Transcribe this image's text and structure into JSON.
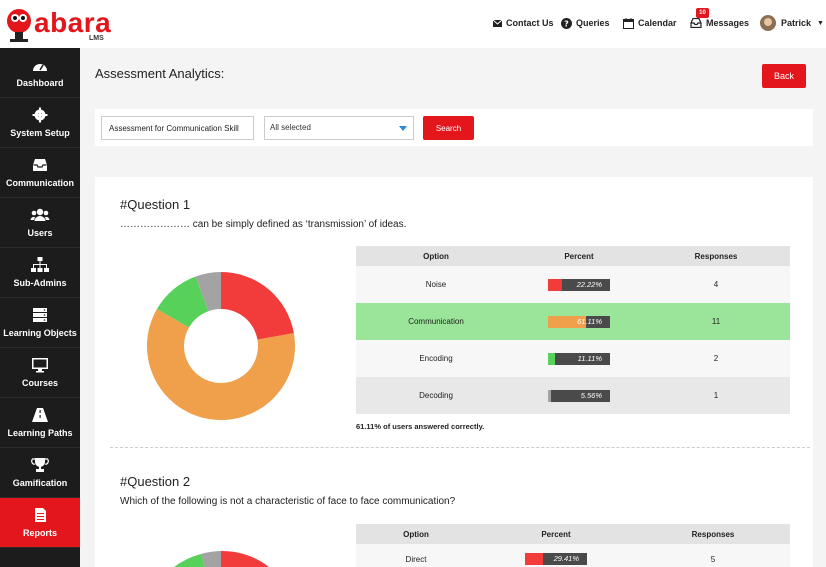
{
  "brand": {
    "name": "abara",
    "sub": "LMS",
    "accent": "#e3161c"
  },
  "topnav": {
    "contact": "Contact Us",
    "queries": "Queries",
    "calendar": "Calendar",
    "messages": "Messages",
    "messages_badge": "10",
    "user": "Patrick"
  },
  "sidebar": {
    "items": [
      {
        "label": "Dashboard",
        "icon": "dashboard-icon"
      },
      {
        "label": "System Setup",
        "icon": "gear-icon"
      },
      {
        "label": "Communication",
        "icon": "inbox-icon"
      },
      {
        "label": "Users",
        "icon": "users-icon"
      },
      {
        "label": "Sub-Admins",
        "icon": "sitemap-icon"
      },
      {
        "label": "Learning Objects",
        "icon": "stack-icon"
      },
      {
        "label": "Courses",
        "icon": "monitor-icon"
      },
      {
        "label": "Learning Paths",
        "icon": "road-icon"
      },
      {
        "label": "Gamification",
        "icon": "trophy-icon"
      },
      {
        "label": "Reports",
        "icon": "report-icon"
      }
    ]
  },
  "page": {
    "title": "Assessment Analytics:",
    "back_label": "Back"
  },
  "filters": {
    "assessment_value": "Assessment for Communication Skill",
    "select_value": "All selected",
    "search_label": "Search"
  },
  "table_headers": {
    "option": "Option",
    "percent": "Percent",
    "responses": "Responses"
  },
  "questions": [
    {
      "title": "#Question 1",
      "text": "………………… can be simply defined as ‘transmission’ of ideas.",
      "options": [
        {
          "option": "Noise",
          "percent_label": "22.22%",
          "percent": 22.22,
          "responses": "4",
          "color": "#f23c3c"
        },
        {
          "option": "Communication",
          "percent_label": "61.11%",
          "percent": 61.11,
          "responses": "11",
          "color": "#f0a04a"
        },
        {
          "option": "Encoding",
          "percent_label": "11.11%",
          "percent": 11.11,
          "responses": "2",
          "color": "#57d15a"
        },
        {
          "option": "Decoding",
          "percent_label": "5.56%",
          "percent": 5.56,
          "responses": "1",
          "color": "#a3a3a3"
        }
      ],
      "correct_index": 1,
      "summary": "61.11% of users answered correctly."
    },
    {
      "title": "#Question 2",
      "text": "Which of the following is not a characteristic of face to face communication?",
      "options": [
        {
          "option": "Direct",
          "percent_label": "29.41%",
          "percent": 29.41,
          "responses": "5",
          "color": "#f23c3c"
        }
      ],
      "chart_colors": [
        "#f23c3c",
        "#f0a04a",
        "#57d15a",
        "#a3a3a3"
      ]
    }
  ]
}
